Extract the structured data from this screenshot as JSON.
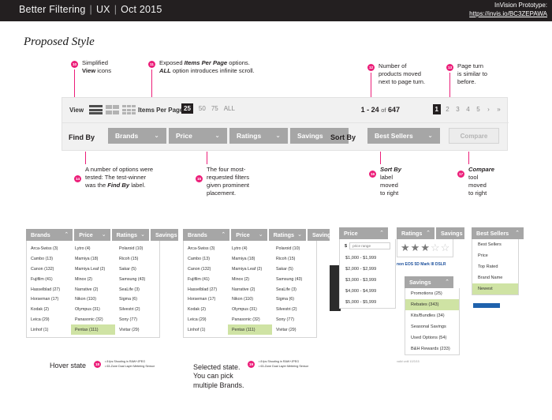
{
  "topbar": {
    "title": "Better Filtering",
    "discipline": "UX",
    "date": "Oct 2015",
    "separator": "|",
    "prototype_label": "InVision Prototype:",
    "prototype_url": "https://invis.io/BC3ZEPAWA"
  },
  "page_title": "Proposed Style",
  "annotations": [
    {
      "id": "10",
      "line1": "Simplified",
      "line2_bold": "View",
      "line2_rest": " icons"
    },
    {
      "id": "11",
      "line1_pre": "Exposed ",
      "line1_em": "Items Per Page",
      "line1_post": " options.",
      "line2_em": "ALL",
      "line2_post": " option introduces infinite scroll."
    },
    {
      "id": "12",
      "line1": "Number of",
      "line2": "products moved",
      "line3": "next to page turn."
    },
    {
      "id": "13",
      "line1": "Page turn",
      "line2": "is similar to",
      "line3": "before."
    },
    {
      "id": "14",
      "line1": "A number of options were",
      "line2": "tested: The test-winner",
      "line3_pre": "was the ",
      "line3_em": "Find By",
      "line3_post": " label."
    },
    {
      "id": "15",
      "line1": "The four most-",
      "line2": "requested filters",
      "line3": "given prominent",
      "line4": "placement."
    },
    {
      "id": "16",
      "title": "Sort By",
      "line2": "label",
      "line3": "moved",
      "line4": "to right"
    },
    {
      "id": "17",
      "title": "Compare",
      "line2": "tool",
      "line3": "moved",
      "line4": "to right"
    },
    {
      "id": "18",
      "caption": "Hover state"
    },
    {
      "id": "19",
      "caption_l1": "Selected state.",
      "caption_l2": "You can pick",
      "caption_l3": "multiple Brands."
    }
  ],
  "toolbar": {
    "view_label": "View",
    "view_icons": [
      "list-view-icon",
      "grid-2-view-icon",
      "grid-3-view-icon"
    ],
    "items_per_page_label": "Items Per Page",
    "items_per_page_options": [
      "25",
      "50",
      "75",
      "ALL"
    ],
    "items_per_page_selected": "25",
    "result_range": "1 - 24",
    "result_of": "of",
    "result_total": "647",
    "pages": [
      "1",
      "2",
      "3",
      "4",
      "5"
    ],
    "page_selected": "1",
    "page_next": "›",
    "page_last": "»",
    "find_by_label": "Find By",
    "filters": [
      "Brands",
      "Price",
      "Ratings",
      "Savings"
    ],
    "sort_by_label": "Sort By",
    "sort_by_value": "Best Sellers",
    "compare_label": "Compare",
    "chevron_down": "⌄",
    "chevron_up": "⌃"
  },
  "brands_panel": {
    "tabs": [
      "Brands",
      "Price",
      "Ratings",
      "Savings"
    ],
    "active_tab": "Brands",
    "columns": [
      [
        "Arca-Swiss (3)",
        "Cambo (13)",
        "Canon (132)",
        "Fujifilm (41)",
        "Hasselblad (27)",
        "Horseman (17)",
        "Kodak (2)",
        "Leica (29)",
        "Linhof (1)"
      ],
      [
        "Lytro (4)",
        "Mamiya (18)",
        "Mamiya Leaf (2)",
        "Minox (2)",
        "Narrative (2)",
        "Nikon (110)",
        "Olympus (31)",
        "Panasonic (32)",
        "Pentax (111)"
      ],
      [
        "Polaroid (10)",
        "Ricoh (15)",
        "Sakar (5)",
        "Samsung (43)",
        "SeaLife (3)",
        "Sigma (6)",
        "Silvestri (2)",
        "Sony (77)",
        "Vivitar (29)"
      ]
    ],
    "highlighted": "Pentax (111)"
  },
  "price_panel": {
    "header": "Price",
    "currency": "$",
    "input_placeholder": "price range",
    "ranges": [
      "$1,000 - $1,999",
      "$2,000 - $2,999",
      "$3,000 - $3,999",
      "$4,000 - $4,999",
      "$5,000 - $5,999"
    ]
  },
  "ratings_panel": {
    "header": "Ratings",
    "next_tab": "Savings",
    "stars_filled": 3,
    "stars_total": 5,
    "product_text": "non EOS 5D Mark III DSLR"
  },
  "savings_panel": {
    "header": "Savings",
    "items": [
      "Promotions (25)",
      "Rebates (343)",
      "Kits/Bundles (34)",
      "Seasonal Savings",
      "Used Options (54)",
      "B&H Rewards (233)"
    ],
    "highlighted": "Rebates (343)"
  },
  "sort_panel": {
    "header": "Best Sellers",
    "items": [
      "Best Sellers",
      "Price",
      "Top Rated",
      "Brand Name",
      "Newest"
    ],
    "highlighted": "Newest"
  },
  "spec_bullets": {
    "line1": "8 fps Shooting in RAW+JPEG",
    "line2": "63-Zone Dual Layer Metering Sensor"
  },
  "fine_print": "valid until 10/3/15",
  "colors": {
    "accent_pink": "#ec1e79",
    "dark_bar": "#231f20",
    "filter_grey": "#a6a6a6",
    "highlight_green": "#cfe3a4"
  }
}
